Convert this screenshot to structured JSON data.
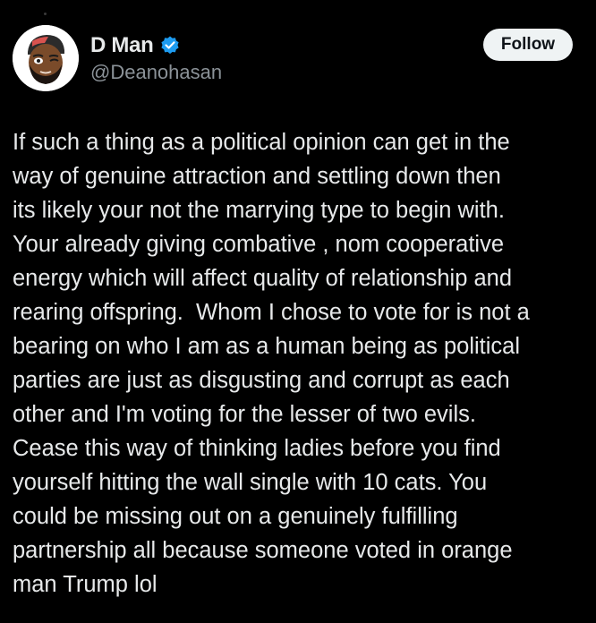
{
  "author": {
    "display_name": "D Man",
    "handle": "@Deanohasan",
    "verified": true,
    "avatar_icon": "profile-avatar-bearded-man",
    "verified_icon": "verified-badge-icon",
    "verified_color": "#1d9bf0"
  },
  "actions": {
    "follow_label": "Follow"
  },
  "tweet": {
    "lines": [
      "If such a thing as a political opinion can get in the",
      "way of genuine attraction and settling down then",
      "its likely your not the marrying type to begin with.",
      "Your already giving combative , nom cooperative",
      "energy which will affect quality of relationship and",
      "rearing offspring.  Whom I chose to vote for is not a",
      "bearing on who I am as a human being as political",
      "parties are just as disgusting and corrupt as each",
      "other and I'm voting for the lesser of two evils.",
      "Cease this way of thinking ladies before you find",
      "yourself hitting the wall single with 10 cats. You",
      "could be missing out on a genuinely fulfilling",
      "partnership all because someone voted in orange",
      "man Trump lol"
    ]
  },
  "colors": {
    "background": "#000000",
    "text_primary": "#e7e9ea",
    "text_secondary": "#8b9298",
    "button_bg": "#eff3f4"
  }
}
